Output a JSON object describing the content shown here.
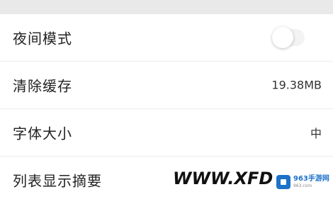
{
  "settings": {
    "rows": [
      {
        "label": "夜间模式",
        "control": "toggle",
        "toggle_on": false
      },
      {
        "label": "清除缓存",
        "value": "19.38MB"
      },
      {
        "label": "字体大小",
        "value": "中"
      },
      {
        "label": "列表显示摘要"
      }
    ]
  },
  "watermark": {
    "text": "WWW.XFDOW",
    "logo_title": "963手游网",
    "logo_sub": "963.com"
  },
  "colors": {
    "background": "#ffffff",
    "label": "#222222",
    "logo_blue": "#1d72c9"
  },
  "icons": {
    "logo": "963-logo-icon"
  }
}
